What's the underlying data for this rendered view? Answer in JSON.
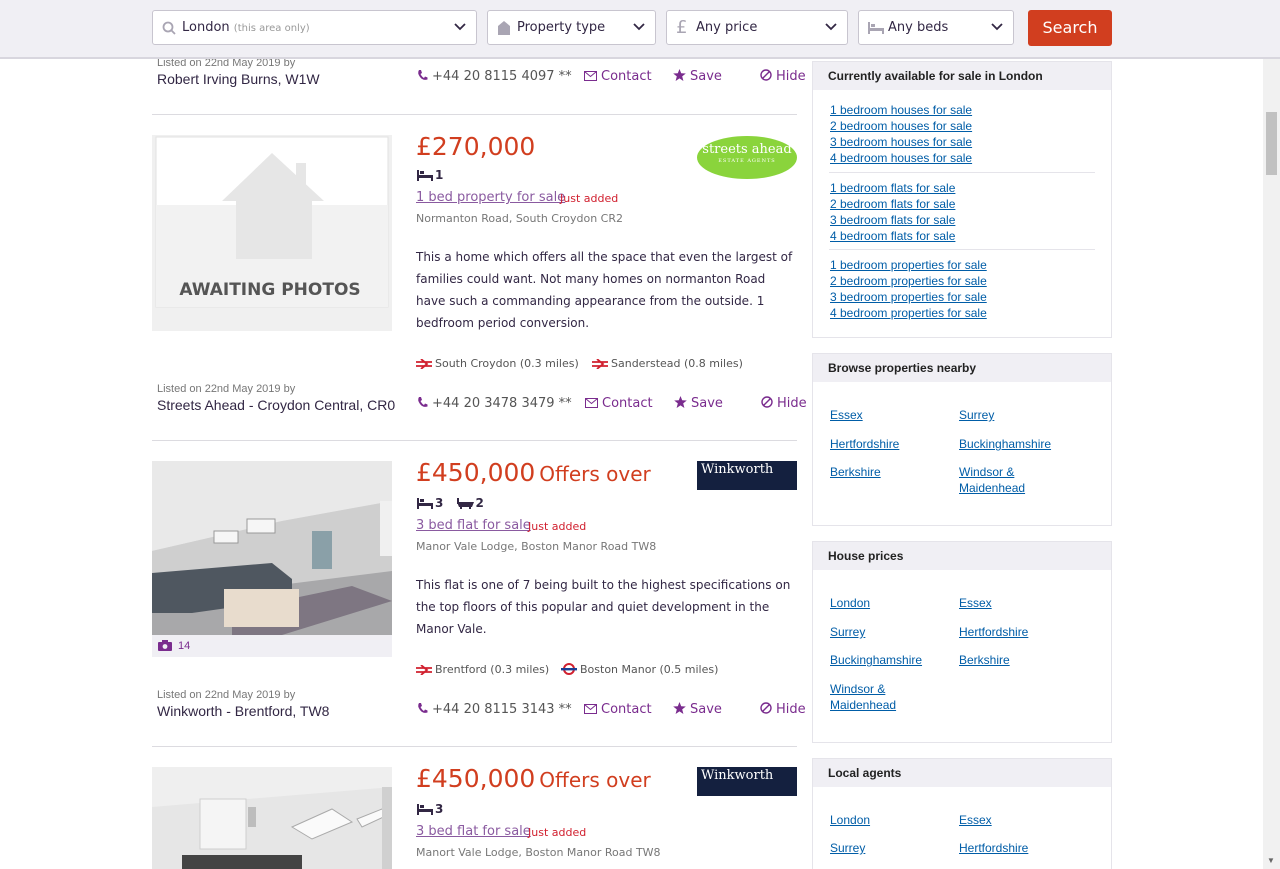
{
  "search": {
    "location": "London",
    "location_note": "(this area only)",
    "property_type": "Property type",
    "price": "Any price",
    "beds": "Any beds",
    "button": "Search"
  },
  "listings": [
    {
      "listed": "Listed on 22nd May 2019 by",
      "agent": "Robert Irving Burns, W1W",
      "phone": "+44 20 8115 4097 **",
      "contact": "Contact",
      "save": "Save",
      "hide": "Hide"
    },
    {
      "price": "£270,000",
      "price_qualifier": "",
      "beds": "1",
      "baths": "",
      "type": "1 bed property for sale",
      "badge": "Just added",
      "address": "Normanton Road, South Croydon CR2",
      "description": "This a home which offers all the space that even the largest of families could want. Not many homes on normanton Road have such a commanding appearance from the outside. 1 bedfroom period conversion.",
      "photo_text": "AWAITING PHOTOS",
      "stations": [
        {
          "name": "South Croydon (0.3 miles)",
          "kind": "rail"
        },
        {
          "name": "Sanderstead (0.8 miles)",
          "kind": "rail"
        }
      ],
      "logo": "streets ahead",
      "logo_sub": "ESTATE AGENTS",
      "listed": "Listed on 22nd May 2019 by",
      "agent": "Streets Ahead - Croydon Central, CR0",
      "phone": "+44 20 3478 3479 **",
      "contact": "Contact",
      "save": "Save",
      "hide": "Hide"
    },
    {
      "price": "£450,000",
      "price_qualifier": "Offers over",
      "beds": "3",
      "baths": "2",
      "type": "3 bed flat for sale",
      "badge": "Just added",
      "address": "Manor Vale Lodge, Boston Manor Road TW8",
      "description": "This flat is one of 7 being built to the highest specifications on the top floors of this popular and quiet development in the Manor Vale.",
      "photo_count": "14",
      "stations": [
        {
          "name": "Brentford (0.3 miles)",
          "kind": "rail"
        },
        {
          "name": "Boston Manor (0.5 miles)",
          "kind": "tube"
        }
      ],
      "logo": "Winkworth",
      "listed": "Listed on 22nd May 2019 by",
      "agent": "Winkworth - Brentford, TW8",
      "phone": "+44 20 8115 3143 **",
      "contact": "Contact",
      "save": "Save",
      "hide": "Hide"
    },
    {
      "price": "£450,000",
      "price_qualifier": "Offers over",
      "beds": "3",
      "type": "3 bed flat for sale",
      "badge": "Just added",
      "address": "Manort Vale Lodge, Boston Manor Road TW8",
      "logo": "Winkworth"
    }
  ],
  "sidebar": {
    "available": {
      "title": "Currently available for sale in London",
      "groups": [
        [
          "1 bedroom houses for sale",
          "2 bedroom houses for sale",
          "3 bedroom houses for sale",
          "4 bedroom houses for sale"
        ],
        [
          "1 bedroom flats for sale",
          "2 bedroom flats for sale",
          "3 bedroom flats for sale",
          "4 bedroom flats for sale"
        ],
        [
          "1 bedroom properties for sale",
          "2 bedroom properties for sale",
          "3 bedroom properties for sale",
          "4 bedroom properties for sale"
        ]
      ]
    },
    "nearby": {
      "title": "Browse properties nearby",
      "links": [
        "Essex",
        "Surrey",
        "Hertfordshire",
        "Buckinghamshire",
        "Berkshire",
        "Windsor & Maidenhead"
      ]
    },
    "house_prices": {
      "title": "House prices",
      "links": [
        "London",
        "Essex",
        "Surrey",
        "Hertfordshire",
        "Buckinghamshire",
        "Berkshire",
        "Windsor & Maidenhead"
      ]
    },
    "local_agents": {
      "title": "Local agents",
      "links": [
        "London",
        "Essex",
        "Surrey",
        "Hertfordshire"
      ]
    }
  },
  "colors": {
    "brand_purple": "#7a2c8e",
    "price_red": "#d13e1f",
    "link_blue": "#005da7"
  }
}
